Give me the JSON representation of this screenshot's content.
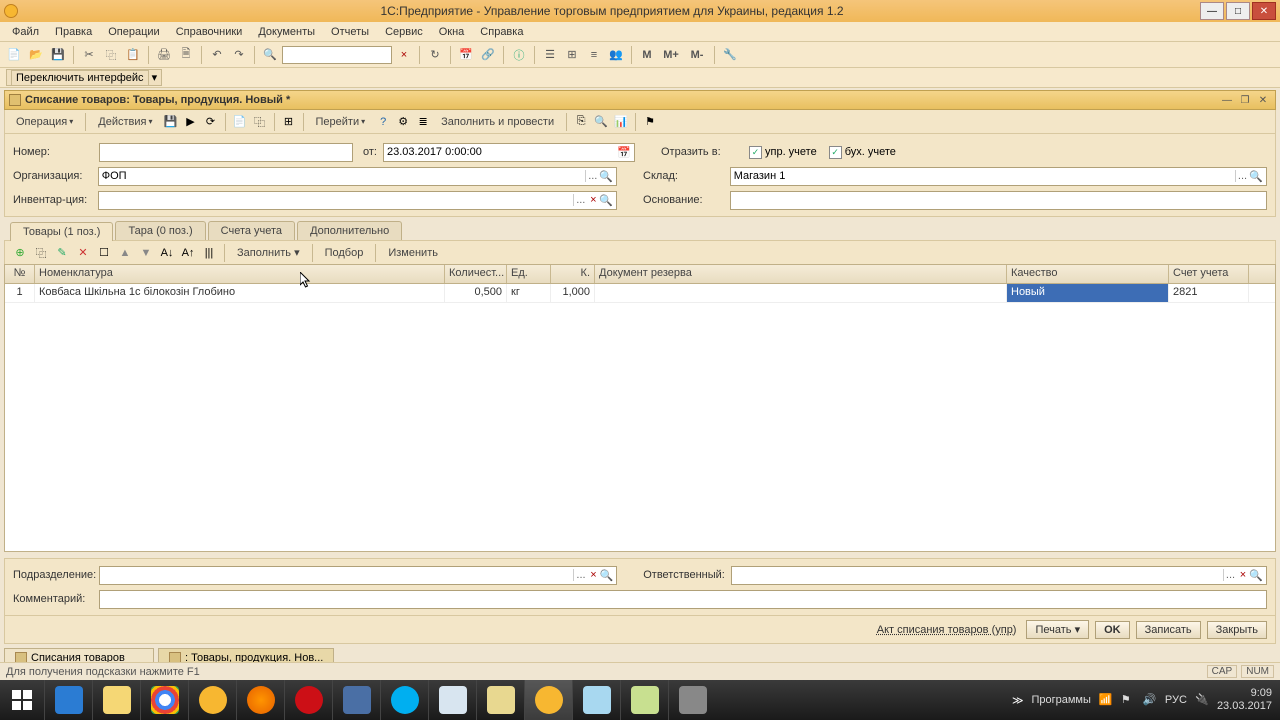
{
  "window": {
    "title": "1С:Предприятие - Управление торговым предприятием для Украины, редакция 1.2"
  },
  "mainmenu": [
    "Файл",
    "Правка",
    "Операции",
    "Справочники",
    "Документы",
    "Отчеты",
    "Сервис",
    "Окна",
    "Справка"
  ],
  "toolbar": {
    "m": "M",
    "mplus": "M+",
    "mminus": "M-"
  },
  "ifswitch": "Переключить интерфейс",
  "doc": {
    "title": "Списание товаров: Товары, продукция. Новый *",
    "operation": "Операция",
    "actions": "Действия",
    "goto": "Перейти",
    "fillpost": "Заполнить и провести"
  },
  "form": {
    "number_lbl": "Номер:",
    "number": "",
    "from_lbl": "от:",
    "date": "23.03.2017 0:00:00",
    "reflect_lbl": "Отразить в:",
    "upr": "упр. учете",
    "buh": "бух. учете",
    "org_lbl": "Организация:",
    "org": "ФОП",
    "sklad_lbl": "Склад:",
    "sklad": "Магазин 1",
    "inv_lbl": "Инвентар-ция:",
    "osn_lbl": "Основание:"
  },
  "tabs": [
    "Товары (1 поз.)",
    "Тара (0 поз.)",
    "Счета учета",
    "Дополнительно"
  ],
  "tabtb": {
    "fill": "Заполнить",
    "podbor": "Подбор",
    "change": "Изменить"
  },
  "grid": {
    "hdr": {
      "n": "№",
      "nom": "Номенклатура",
      "qty": "Количест...",
      "ed": "Ед.",
      "k": "К.",
      "doc": "Документ резерва",
      "qual": "Качество",
      "acc": "Счет учета"
    },
    "rows": [
      {
        "n": "1",
        "nom": "Ковбаса Шкільна 1с білокозін Глобино",
        "qty": "0,500",
        "ed": "кг",
        "k": "1,000",
        "doc": "",
        "qual": "Новый",
        "acc": "2821"
      }
    ]
  },
  "bottom": {
    "podr_lbl": "Подразделение:",
    "otv_lbl": "Ответственный:",
    "comm_lbl": "Комментарий:"
  },
  "buttons": {
    "akt": "Акт списания товаров (упр)",
    "print": "Печать",
    "ok": "OK",
    "save": "Записать",
    "close": "Закрыть"
  },
  "wintabs": [
    {
      "label": "Списания товаров",
      "active": false
    },
    {
      "label": ": Товары, продукция. Нов...",
      "active": true
    }
  ],
  "status": {
    "hint": "Для получения подсказки нажмите F1",
    "cap": "CAP",
    "num": "NUM"
  },
  "tray": {
    "prog": "Программы",
    "lang": "РУС",
    "time": "9:09",
    "date": "23.03.2017"
  }
}
